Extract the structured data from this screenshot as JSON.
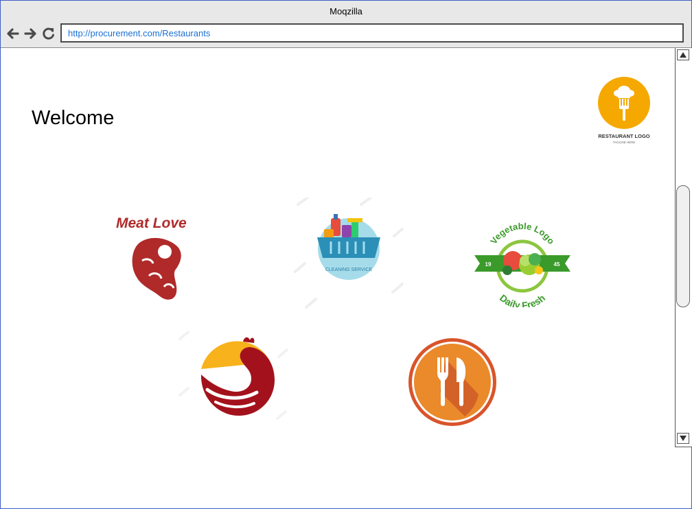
{
  "browser": {
    "title": "Moqzilla",
    "url": "http://procurement.com/Restaurants"
  },
  "page": {
    "welcome": "Welcome",
    "header_logo": {
      "icon": "chef-fork-icon",
      "label": "RESTAURANT LOGO",
      "tagline": "TAGLINE HERE"
    }
  },
  "vendors": [
    {
      "icon": "meat-steak-icon",
      "label": "Meat Love"
    },
    {
      "icon": "cleaning-basket-icon",
      "label": "CLEANING SERVICE"
    },
    {
      "icon": "vegetable-icon",
      "label_top": "Vegetable Logo",
      "label_bottom": "Daily Fresh",
      "year_left": "19",
      "year_right": "45"
    },
    {
      "icon": "rooster-icon"
    },
    {
      "icon": "fork-knife-icon"
    }
  ],
  "colors": {
    "window_border": "#3d5bc4",
    "url_text": "#1a6fd4",
    "logo_orange": "#f5a800",
    "meat_red": "#b02a2a",
    "veg_green": "#3a9a2a",
    "rooster_red": "#a3121c",
    "cutlery_orange": "#ea8a2a"
  }
}
